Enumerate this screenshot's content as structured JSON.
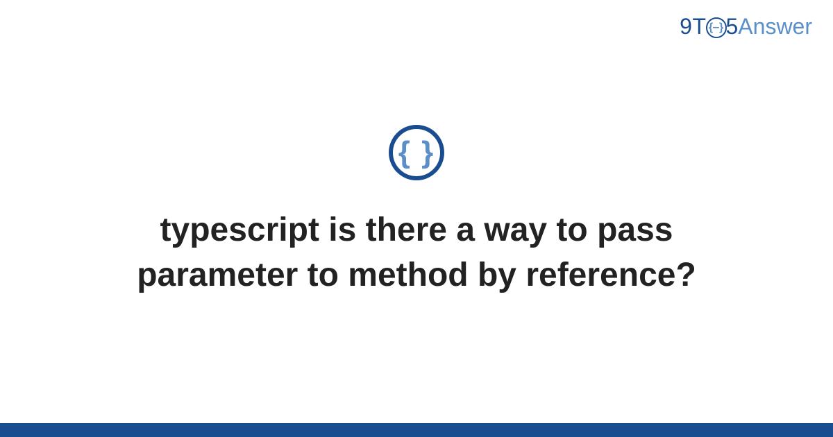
{
  "logo": {
    "part1": "9T",
    "circle_inner": "{&}",
    "part2": "5",
    "part3": "Answer"
  },
  "icon": {
    "name": "code-braces-icon",
    "glyph": "{ }"
  },
  "title": "typescript is there a way to pass parameter to method by reference?",
  "colors": {
    "brand_dark": "#1a4d8f",
    "brand_light": "#5a8fc7",
    "text": "#222222"
  }
}
